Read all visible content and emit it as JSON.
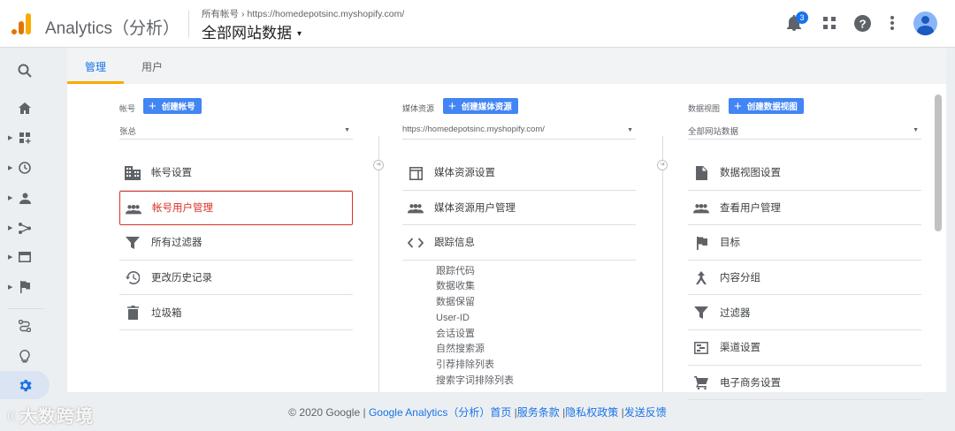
{
  "header": {
    "app_title": "Analytics（分析）",
    "breadcrumb_all_accounts": "所有帐号",
    "breadcrumb_arrow": "›",
    "breadcrumb_property": "https://homedepotsinc.myshopify.com/",
    "view_name": "全部网站数据",
    "view_caret": "▾",
    "notification_count": "3"
  },
  "tabs": [
    {
      "label": "管理",
      "active": true
    },
    {
      "label": "用户",
      "active": false
    }
  ],
  "account_col": {
    "label": "帐号",
    "create_label": "创建帐号",
    "selected": "张总",
    "items": [
      {
        "label": "帐号设置",
        "icon": "building-icon"
      },
      {
        "label": "帐号用户管理",
        "icon": "people-icon",
        "highlighted": true
      },
      {
        "label": "所有过滤器",
        "icon": "filter-icon"
      },
      {
        "label": "更改历史记录",
        "icon": "history-icon"
      },
      {
        "label": "垃圾箱",
        "icon": "trash-icon"
      }
    ]
  },
  "property_col": {
    "label": "媒体资源",
    "create_label": "创建媒体资源",
    "selected": "https://homedepotsinc.myshopify.com/",
    "items": [
      {
        "label": "媒体资源设置",
        "icon": "window-icon"
      },
      {
        "label": "媒体资源用户管理",
        "icon": "people-icon"
      },
      {
        "label": "跟踪信息",
        "icon": "code-icon"
      }
    ],
    "tracking_sub": [
      "跟踪代码",
      "数据收集",
      "数据保留",
      "User-ID",
      "会话设置",
      "自然搜索源",
      "引荐排除列表",
      "搜索字词排除列表"
    ]
  },
  "view_col": {
    "label": "数据视图",
    "create_label": "创建数据视图",
    "selected": "全部网站数据",
    "items": [
      {
        "label": "数据视图设置",
        "icon": "document-icon"
      },
      {
        "label": "查看用户管理",
        "icon": "people-icon"
      },
      {
        "label": "目标",
        "icon": "flag-icon"
      },
      {
        "label": "内容分组",
        "icon": "person-walk-icon"
      },
      {
        "label": "过滤器",
        "icon": "filter-icon"
      },
      {
        "label": "渠道设置",
        "icon": "channel-icon"
      },
      {
        "label": "电子商务设置",
        "icon": "cart-icon"
      }
    ]
  },
  "footer": {
    "copyright": "© 2020 Google",
    "sep": "|",
    "link_ga": "Google Analytics（分析）首页",
    "link_terms": "服务条款",
    "link_privacy": "隐私权政策",
    "link_feedback": "发送反馈"
  },
  "watermark": {
    "brand_mark": "((",
    "text": "大数跨境"
  },
  "colors": {
    "accent": "#1a73e8",
    "create_button": "#4285f4",
    "highlight_border": "#d93025",
    "tab_underline": "#f9ab00"
  }
}
